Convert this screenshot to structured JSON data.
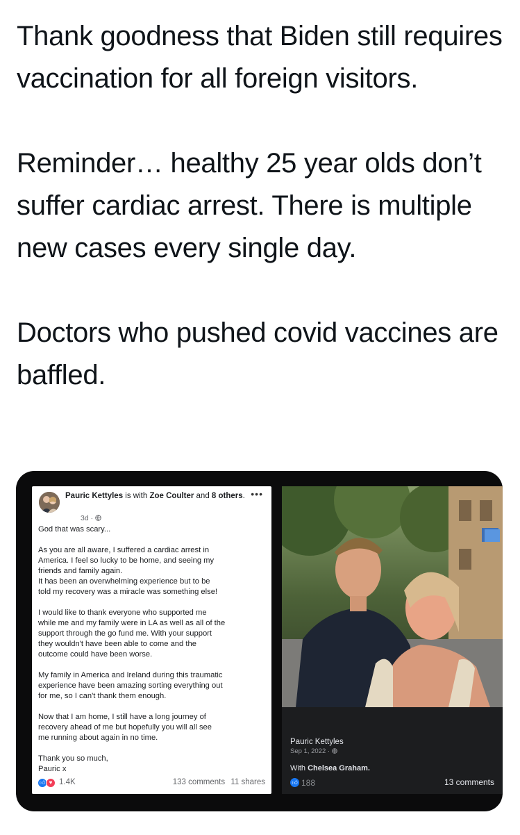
{
  "tweet": {
    "paragraphs": [
      "Thank goodness that Biden still requires vaccination for all foreign visitors.",
      "Reminder… healthy 25 year olds don’t suffer cardiac arrest. There is multiple new cases every single day.",
      "Doctors who pushed covid vaccines are baffled."
    ]
  },
  "fb_post": {
    "author": "Pauric Kettyles",
    "with_text": " is with ",
    "tagged": "Zoe Coulter",
    "and_text": " and ",
    "others": "8 others",
    "time": "3d ·",
    "more_icon": "ellipsis-icon",
    "globe_icon": "globe-icon",
    "body": [
      "God that was scary...",
      "As you are all aware, I suffered a cardiac arrest in\nAmerica. I feel so lucky to be home, and seeing my\nfriends and family again.\nIt has been an overwhelming experience but to be\ntold my recovery was a miracle was something else!",
      "I would like to thank everyone who supported me\nwhile me and my family were in LA as well as all of the\nsupport through the go fund me. With your support\nthey wouldn't have been able to come and the\noutcome could have been worse.",
      "My family in America and Ireland during this traumatic\nexperience have been amazing sorting everything out\nfor me, so I can't thank them enough.",
      "Now that I am home, I still have a long journey of\nrecovery ahead of me but hopefully you will all see\nme running about again in no time.",
      "Thank you so much,\nPauric x"
    ],
    "reactions_count": "1.4K",
    "comments": "133 comments",
    "shares": "11 shares"
  },
  "photo_post": {
    "author": "Pauric Kettyles",
    "date": "Sep 1, 2022 ·",
    "with_label": "With ",
    "with_name": "Chelsea Graham.",
    "likes": "188",
    "comments": "13 comments"
  },
  "colors": {
    "text": "#0f1419",
    "fb_blue": "#1877f2",
    "fb_red": "#f33e58",
    "media_bg": "#0b0b0c",
    "dark_card": "#1c1d1f"
  }
}
